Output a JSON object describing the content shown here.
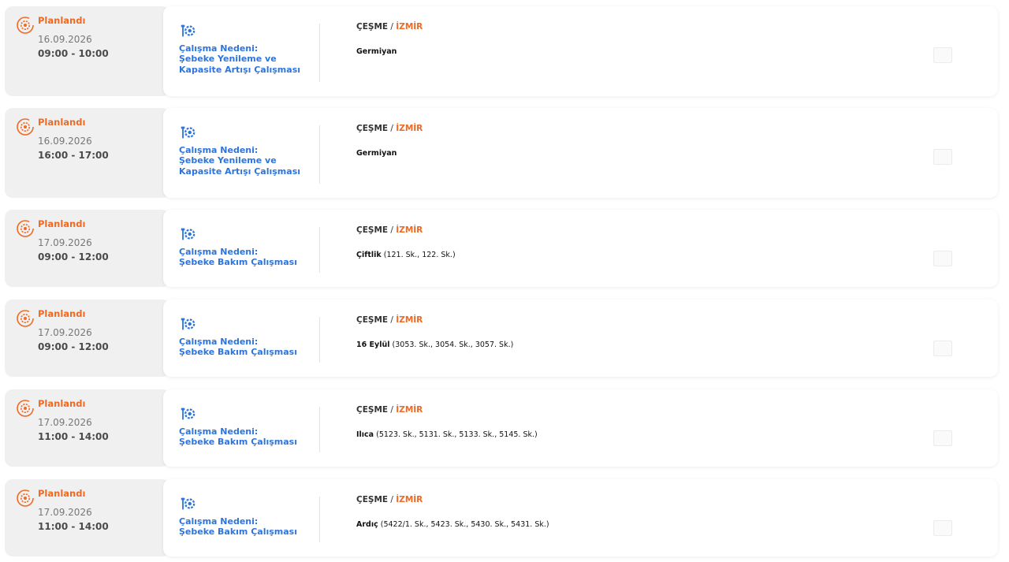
{
  "outages": [
    {
      "status": "Planlandı",
      "date": "16.09.2026",
      "time": "09:00 - 10:00",
      "reason_label": "Çalışma Nedeni:",
      "reason": "Şebeke Yenileme ve Kapasite Artışı Çalışması",
      "district": "ÇEŞME",
      "city": "İZMİR",
      "neighborhood": "Germiyan",
      "streets": ""
    },
    {
      "status": "Planlandı",
      "date": "16.09.2026",
      "time": "16:00 - 17:00",
      "reason_label": "Çalışma Nedeni:",
      "reason": "Şebeke Yenileme ve Kapasite Artışı Çalışması",
      "district": "ÇEŞME",
      "city": "İZMİR",
      "neighborhood": "Germiyan",
      "streets": ""
    },
    {
      "status": "Planlandı",
      "date": "17.09.2026",
      "time": "09:00 - 12:00",
      "reason_label": "Çalışma Nedeni:",
      "reason": "Şebeke Bakım Çalışması",
      "district": "ÇEŞME",
      "city": "İZMİR",
      "neighborhood": "Çiftlik",
      "streets": " (121. Sk., 122. Sk.)"
    },
    {
      "status": "Planlandı",
      "date": "17.09.2026",
      "time": "09:00 - 12:00",
      "reason_label": "Çalışma Nedeni:",
      "reason": "Şebeke Bakım Çalışması",
      "district": "ÇEŞME",
      "city": "İZMİR",
      "neighborhood": "16 Eylül",
      "streets": " (3053. Sk., 3054. Sk., 3057. Sk.)"
    },
    {
      "status": "Planlandı",
      "date": "17.09.2026",
      "time": "11:00 - 14:00",
      "reason_label": "Çalışma Nedeni:",
      "reason": "Şebeke Bakım Çalışması",
      "district": "ÇEŞME",
      "city": "İZMİR",
      "neighborhood": "Ilıca",
      "streets": " (5123. Sk., 5131. Sk., 5133. Sk., 5145. Sk.)"
    },
    {
      "status": "Planlandı",
      "date": "17.09.2026",
      "time": "11:00 - 14:00",
      "reason_label": "Çalışma Nedeni:",
      "reason": "Şebeke Bakım Çalışması",
      "district": "ÇEŞME",
      "city": "İZMİR",
      "neighborhood": "Ardıç",
      "streets": " (5422/1. Sk., 5423. Sk., 5430. Sk., 5431. Sk.)"
    }
  ],
  "icons": {
    "status": "gear-cycle-icon",
    "reason": "wrench-gear-icon"
  },
  "colors": {
    "status": "#ef6a25",
    "reason": "#2d74dd"
  }
}
